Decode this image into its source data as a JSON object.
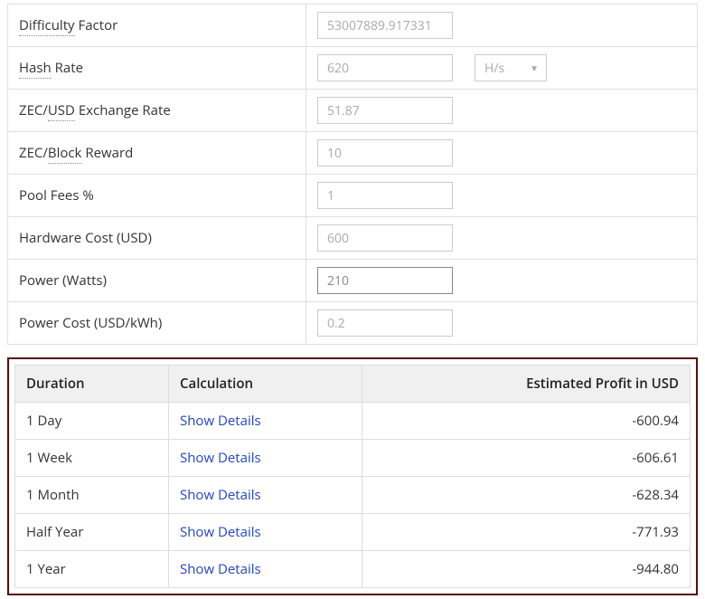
{
  "form": {
    "rows": [
      {
        "label_pre": "",
        "label_dotted": "Difficulty",
        "label_post": " Factor",
        "value": "53007889.917331",
        "active": false,
        "has_unit": false
      },
      {
        "label_pre": "",
        "label_dotted": "Hash",
        "label_post": " Rate",
        "value": "620",
        "active": false,
        "has_unit": true,
        "unit": "H/s"
      },
      {
        "label_pre": "ZEC/",
        "label_dotted": "USD",
        "label_post": " Exchange Rate",
        "value": "51.87",
        "active": false,
        "has_unit": false
      },
      {
        "label_pre": "ZEC/",
        "label_dotted": "Block",
        "label_post": " Reward",
        "value": "10",
        "active": false,
        "has_unit": false
      },
      {
        "label_pre": "",
        "label_dotted": "",
        "label_post": "Pool Fees %",
        "value": "1",
        "active": false,
        "has_unit": false
      },
      {
        "label_pre": "",
        "label_dotted": "",
        "label_post": "Hardware Cost (USD)",
        "value": "600",
        "active": false,
        "has_unit": false
      },
      {
        "label_pre": "",
        "label_dotted": "",
        "label_post": "Power (Watts)",
        "value": "210",
        "active": true,
        "has_unit": false
      },
      {
        "label_pre": "",
        "label_dotted": "",
        "label_post": "Power Cost (USD/kWh)",
        "value": "0.2",
        "active": false,
        "has_unit": false
      }
    ]
  },
  "results": {
    "headers": {
      "duration": "Duration",
      "calculation": "Calculation",
      "profit": "Estimated Profit in USD"
    },
    "show_details_label": "Show Details",
    "rows": [
      {
        "duration": "1 Day",
        "profit": "-600.94"
      },
      {
        "duration": "1 Week",
        "profit": "-606.61"
      },
      {
        "duration": "1 Month",
        "profit": "-628.34"
      },
      {
        "duration": "Half Year",
        "profit": "-771.93"
      },
      {
        "duration": "1 Year",
        "profit": "-944.80"
      }
    ]
  }
}
